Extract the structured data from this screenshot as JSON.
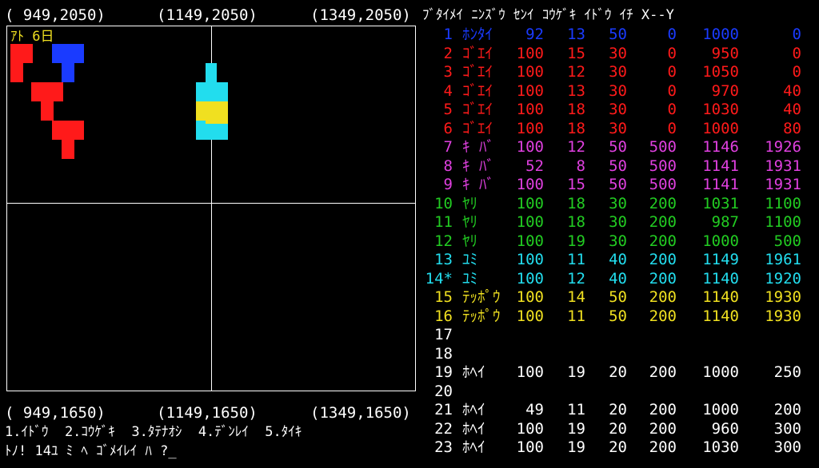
{
  "coords": {
    "top_left": "( 949,2050)",
    "top_mid": "(1149,2050)",
    "top_right": "(1349,2050)",
    "bottom_left": "( 949,1650)",
    "bottom_mid": "(1149,1650)",
    "bottom_right": "(1349,1650)"
  },
  "days_left": "ｱﾄ 6日",
  "header": "ﾌﾞﾀｲﾒｲ ﾆﾝｽﾞｳ ｾﾝｲ ｺｳｹﾞｷ ｲﾄﾞｳ ｲﾁ X--Y",
  "colors": {
    "blue": "#1a3bff",
    "red": "#ff1a1a",
    "magenta": "#e040e0",
    "green": "#22cc22",
    "cyan": "#22ddee",
    "yellow": "#f0e020",
    "white": "#ffffff"
  },
  "units": [
    {
      "no": "1",
      "name": "ﾎﾝﾀｲ",
      "men": "92",
      "morale": "13",
      "attack": "50",
      "move": "0",
      "x": "1000",
      "y": "0",
      "color": "blue"
    },
    {
      "no": "2",
      "name": "ｺﾞｴｲ",
      "men": "100",
      "morale": "15",
      "attack": "30",
      "move": "0",
      "x": "950",
      "y": "0",
      "color": "red"
    },
    {
      "no": "3",
      "name": "ｺﾞｴｲ",
      "men": "100",
      "morale": "12",
      "attack": "30",
      "move": "0",
      "x": "1050",
      "y": "0",
      "color": "red"
    },
    {
      "no": "4",
      "name": "ｺﾞｴｲ",
      "men": "100",
      "morale": "13",
      "attack": "30",
      "move": "0",
      "x": "970",
      "y": "40",
      "color": "red"
    },
    {
      "no": "5",
      "name": "ｺﾞｴｲ",
      "men": "100",
      "morale": "18",
      "attack": "30",
      "move": "0",
      "x": "1030",
      "y": "40",
      "color": "red"
    },
    {
      "no": "6",
      "name": "ｺﾞｴｲ",
      "men": "100",
      "morale": "18",
      "attack": "30",
      "move": "0",
      "x": "1000",
      "y": "80",
      "color": "red"
    },
    {
      "no": "7",
      "name": "ｷ ﾊﾞ",
      "men": "100",
      "morale": "12",
      "attack": "50",
      "move": "500",
      "x": "1146",
      "y": "1926",
      "color": "magenta"
    },
    {
      "no": "8",
      "name": "ｷ ﾊﾞ",
      "men": "52",
      "morale": "8",
      "attack": "50",
      "move": "500",
      "x": "1141",
      "y": "1931",
      "color": "magenta"
    },
    {
      "no": "9",
      "name": "ｷ ﾊﾞ",
      "men": "100",
      "morale": "15",
      "attack": "50",
      "move": "500",
      "x": "1141",
      "y": "1931",
      "color": "magenta"
    },
    {
      "no": "10",
      "name": "ﾔﾘ",
      "men": "100",
      "morale": "18",
      "attack": "30",
      "move": "200",
      "x": "1031",
      "y": "1100",
      "color": "green"
    },
    {
      "no": "11",
      "name": "ﾔﾘ",
      "men": "100",
      "morale": "18",
      "attack": "30",
      "move": "200",
      "x": "987",
      "y": "1100",
      "color": "green"
    },
    {
      "no": "12",
      "name": "ﾔﾘ",
      "men": "100",
      "morale": "19",
      "attack": "30",
      "move": "200",
      "x": "1000",
      "y": "500",
      "color": "green"
    },
    {
      "no": "13",
      "name": "ﾕﾐ",
      "men": "100",
      "morale": "11",
      "attack": "40",
      "move": "200",
      "x": "1149",
      "y": "1961",
      "color": "cyan"
    },
    {
      "no": "14*",
      "name": "ﾕﾐ",
      "men": "100",
      "morale": "12",
      "attack": "40",
      "move": "200",
      "x": "1140",
      "y": "1920",
      "color": "cyan"
    },
    {
      "no": "15",
      "name": "ﾃｯﾎﾟｳ",
      "men": "100",
      "morale": "14",
      "attack": "50",
      "move": "200",
      "x": "1140",
      "y": "1930",
      "color": "yellow"
    },
    {
      "no": "16",
      "name": "ﾃｯﾎﾟｳ",
      "men": "100",
      "morale": "11",
      "attack": "50",
      "move": "200",
      "x": "1140",
      "y": "1930",
      "color": "yellow"
    },
    {
      "no": "17",
      "name": "",
      "men": "",
      "morale": "",
      "attack": "",
      "move": "",
      "x": "",
      "y": "",
      "color": "white"
    },
    {
      "no": "18",
      "name": "",
      "men": "",
      "morale": "",
      "attack": "",
      "move": "",
      "x": "",
      "y": "",
      "color": "white"
    },
    {
      "no": "19",
      "name": "ﾎﾍｲ",
      "men": "100",
      "morale": "19",
      "attack": "20",
      "move": "200",
      "x": "1000",
      "y": "250",
      "color": "white"
    },
    {
      "no": "20",
      "name": "",
      "men": "",
      "morale": "",
      "attack": "",
      "move": "",
      "x": "",
      "y": "",
      "color": "white"
    },
    {
      "no": "21",
      "name": "ﾎﾍｲ",
      "men": "49",
      "morale": "11",
      "attack": "20",
      "move": "200",
      "x": "1000",
      "y": "200",
      "color": "white"
    },
    {
      "no": "22",
      "name": "ﾎﾍｲ",
      "men": "100",
      "morale": "19",
      "attack": "20",
      "move": "200",
      "x": "960",
      "y": "300",
      "color": "white"
    },
    {
      "no": "23",
      "name": "ﾎﾍｲ",
      "men": "100",
      "morale": "19",
      "attack": "20",
      "move": "200",
      "x": "1030",
      "y": "300",
      "color": "white"
    }
  ],
  "command_menu": "1.ｲﾄﾞｳ  2.ｺｳｹﾞｷ  3.ﾀﾃﾅｵｼ  4.ﾃﾞﾝﾚｲ  5.ﾀｲｷ",
  "prompt": "ﾄﾉ! 14ﾕ ﾐ ﾍ ｺﾞﾒｲﾚｲ ﾊ ?_"
}
